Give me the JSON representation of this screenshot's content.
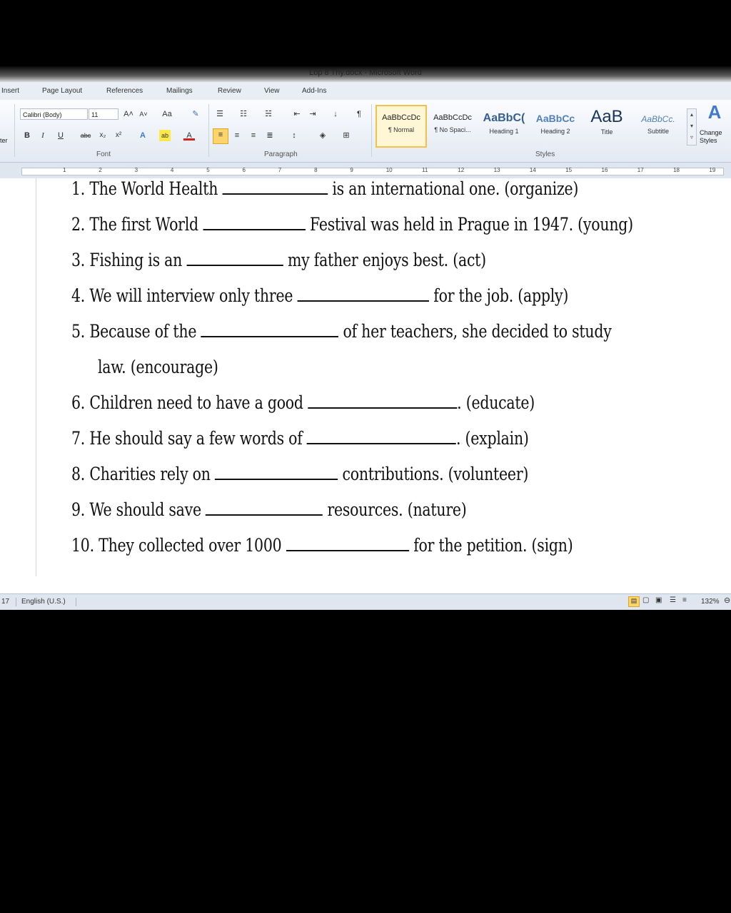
{
  "window": {
    "title": "Lop 8 Thy.docx - Microsoft Word"
  },
  "menu": {
    "tabs": [
      "Insert",
      "Page Layout",
      "References",
      "Mailings",
      "Review",
      "View",
      "Add-Ins"
    ]
  },
  "ribbon": {
    "clipboard_cut": "ter",
    "font": {
      "name": "Calibri (Body)",
      "size": "11",
      "group_label": "Font"
    },
    "paragraph": {
      "group_label": "Paragraph"
    },
    "styles": {
      "group_label": "Styles",
      "items": [
        {
          "preview": "AaBbCcDc",
          "name": "¶ Normal"
        },
        {
          "preview": "AaBbCcDc",
          "name": "¶ No Spaci..."
        },
        {
          "preview": "AaBbC(",
          "name": "Heading 1"
        },
        {
          "preview": "AaBbCc",
          "name": "Heading 2"
        },
        {
          "preview": "AaB",
          "name": "Title"
        },
        {
          "preview": "AaBbCc.",
          "name": "Subtitle"
        }
      ],
      "change_styles": "Change Styles"
    }
  },
  "ruler": {
    "numbers": [
      "1",
      "2",
      "3",
      "4",
      "5",
      "6",
      "7",
      "8",
      "9",
      "10",
      "11",
      "12",
      "13",
      "14",
      "15",
      "16",
      "17",
      "18",
      "19"
    ]
  },
  "document": {
    "items": [
      {
        "num": "1.",
        "before": "The World Health",
        "after": "is an international one. (organize)"
      },
      {
        "num": "2.",
        "before": "The first World",
        "after": "Festival was held in Prague in 1947. (young)"
      },
      {
        "num": "3.",
        "before": "Fishing is an",
        "after": "my father enjoys best. (act)"
      },
      {
        "num": "4.",
        "before": "We will interview only three",
        "after": "for the job. (apply)"
      },
      {
        "num": "5.",
        "before": "Because of the",
        "after": "of her teachers, she decided to study",
        "cont": "law. (encourage)"
      },
      {
        "num": "6.",
        "before": "Children need to have a good",
        "after": ". (educate)"
      },
      {
        "num": "7.",
        "before": "He should say a few words of",
        "after": ". (explain)"
      },
      {
        "num": "8.",
        "before": "Charities rely on",
        "after": "contributions. (volunteer)"
      },
      {
        "num": "9.",
        "before": "We should save",
        "after": "resources. (nature)"
      },
      {
        "num": "10.",
        "before": "They collected over 1000",
        "after": "for the petition. (sign)"
      }
    ]
  },
  "status": {
    "page": "17",
    "language": "English (U.S.)",
    "zoom": "132%"
  }
}
